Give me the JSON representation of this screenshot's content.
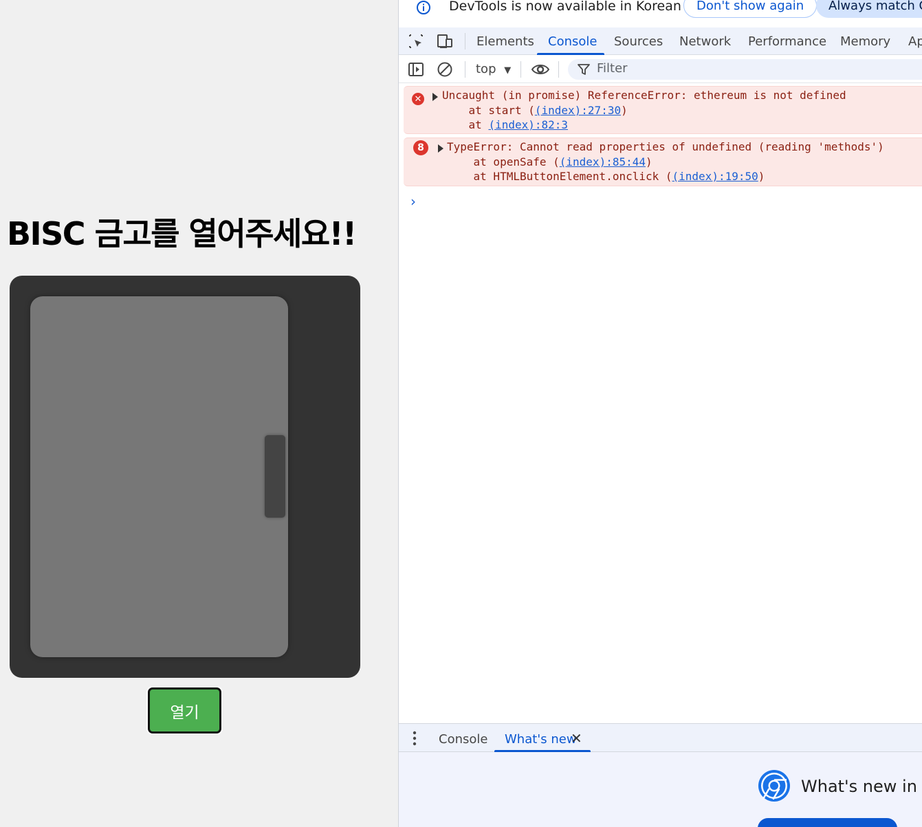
{
  "page": {
    "title": "BISC 금고를 열어주세요!!",
    "open_button_label": "열기"
  },
  "devtools": {
    "infobar": {
      "message": "DevTools is now available in Korean",
      "dont_show_label": "Don't show again",
      "always_match_label": "Always match Ch"
    },
    "tabs": [
      "Elements",
      "Console",
      "Sources",
      "Network",
      "Performance",
      "Memory",
      "Ap"
    ],
    "active_tab": "Console",
    "toolbar": {
      "context": "top",
      "filter_placeholder": "Filter"
    },
    "messages": [
      {
        "icon": "error-icon",
        "lines": [
          {
            "prefix": "Uncaught (in promise) ReferenceError: ethereum is not defined"
          },
          {
            "prefix": "    at start (",
            "link": "(index):27:30",
            "suffix": ")"
          },
          {
            "prefix": "    at ",
            "link": "(index):82:3",
            "suffix": ""
          }
        ]
      },
      {
        "icon": "error-count-badge",
        "count": "8",
        "lines": [
          {
            "prefix": "TypeError: Cannot read properties of undefined (reading 'methods')"
          },
          {
            "prefix": "    at openSafe (",
            "link": "(index):85:44",
            "suffix": ")"
          },
          {
            "prefix": "    at HTMLButtonElement.onclick (",
            "link": "(index):19:50",
            "suffix": ")"
          }
        ]
      }
    ],
    "drawer": {
      "tabs": [
        "Console",
        "What's new"
      ],
      "active_tab": "What's new",
      "close_symbol": "✕",
      "heading": "What's new in D"
    },
    "colors": {
      "accent": "#0b57d0",
      "error": "#dc362e",
      "error_bg": "#fce8e6",
      "button_green": "#4caf50"
    }
  }
}
